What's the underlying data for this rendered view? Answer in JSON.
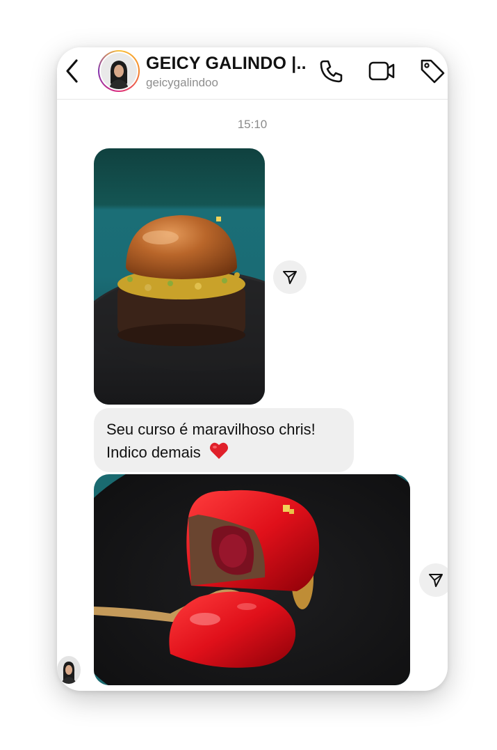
{
  "header": {
    "contact_name": "GEICY GALINDO |...",
    "username": "geicygalindoo",
    "icons": [
      "back-chevron-icon",
      "phone-icon",
      "video-camera-icon",
      "tag-icon"
    ]
  },
  "conversation": {
    "timestamp": "15:10",
    "messages": [
      {
        "type": "image",
        "description_icon": "dessert-photo"
      },
      {
        "type": "text",
        "line1": "Seu curso é maravilhoso chris!",
        "line2": "Indico demais",
        "emoji": "red-heart-icon"
      },
      {
        "type": "image",
        "description_icon": "dessert-photo"
      }
    ]
  },
  "colors": {
    "accent_text": "#111111",
    "secondary_text": "#8e8e8e",
    "bubble_bg": "#efefef",
    "heart": "#e0202a"
  }
}
